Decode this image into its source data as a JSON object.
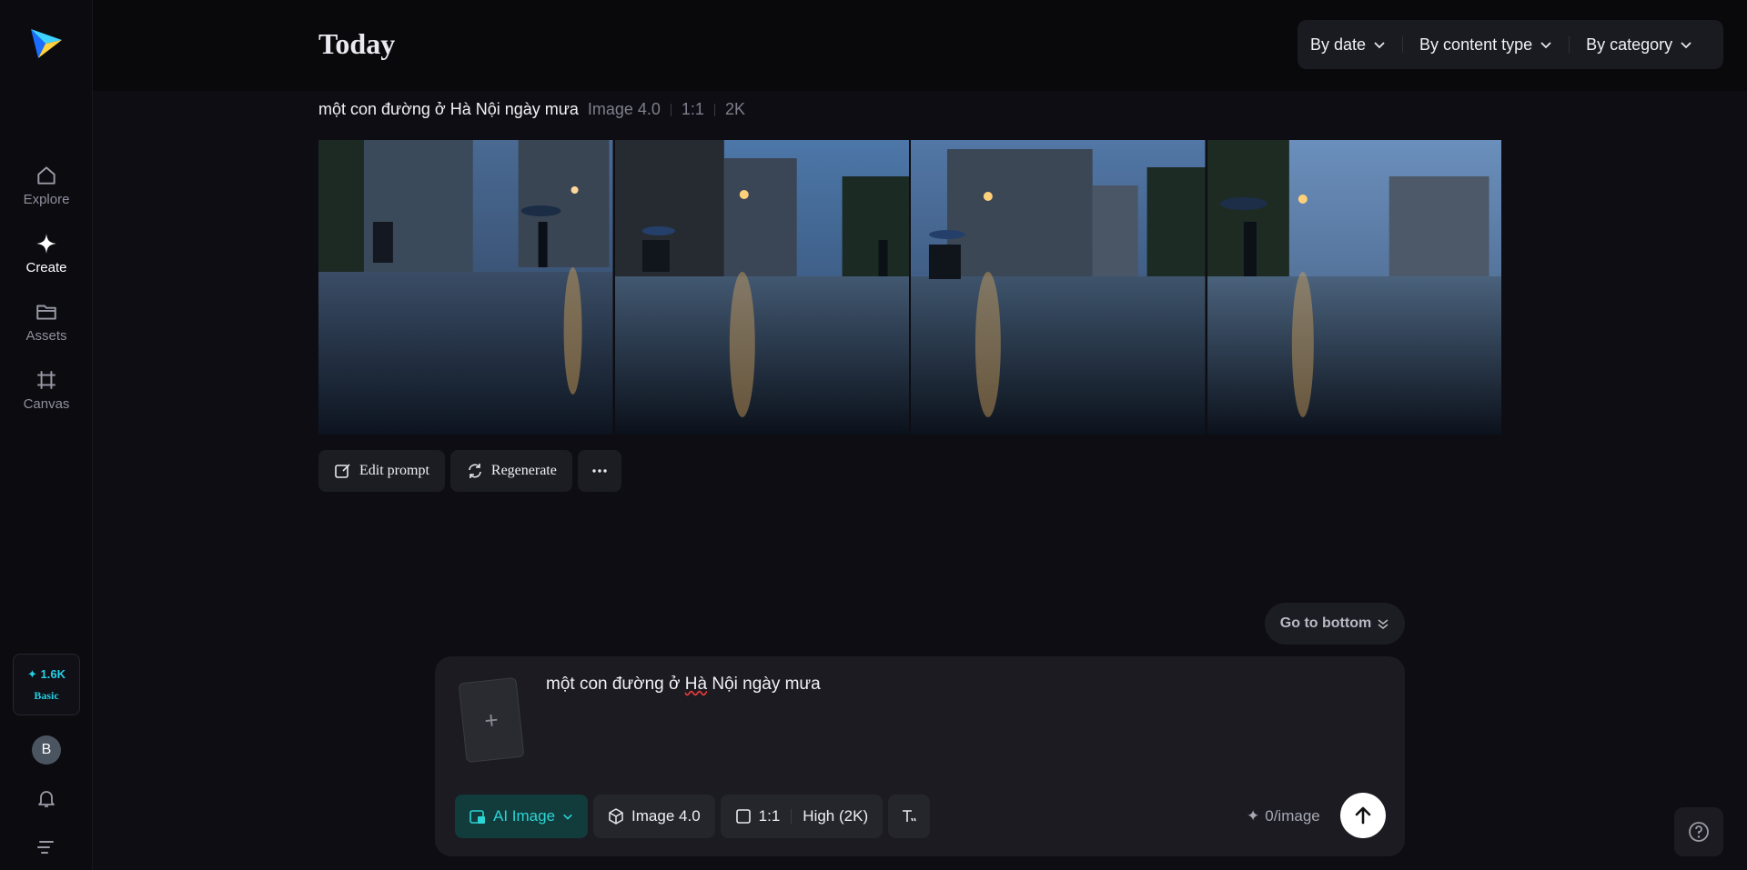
{
  "sidebar": {
    "items": [
      {
        "label": "Explore",
        "icon": "home-icon",
        "active": false
      },
      {
        "label": "Create",
        "icon": "sparkle-icon",
        "active": true
      },
      {
        "label": "Assets",
        "icon": "folder-icon",
        "active": false
      },
      {
        "label": "Canvas",
        "icon": "canvas-icon",
        "active": false
      }
    ],
    "credits": {
      "amount": "1.6K",
      "plan": "Basic"
    },
    "avatar_initial": "B"
  },
  "header": {
    "title": "Today",
    "filters": [
      {
        "label": "By date"
      },
      {
        "label": "By content type"
      },
      {
        "label": "By category"
      }
    ]
  },
  "generation": {
    "prompt": "một con đường ở Hà Nội ngày mưa",
    "model": "Image 4.0",
    "ratio": "1:1",
    "resolution": "2K",
    "image_count": 4,
    "actions": {
      "edit_label": "Edit prompt",
      "regenerate_label": "Regenerate"
    }
  },
  "go_bottom_label": "Go to bottom",
  "composer": {
    "input_value_pre": "một con đường ở ",
    "input_value_misspelled": "Hà",
    "input_value_post": " Nội ngày mưa",
    "mode_label": "AI Image",
    "model_label": "Image 4.0",
    "ratio_label": "1:1",
    "quality_label": "High (2K)",
    "cost_label": "0/image"
  },
  "colors": {
    "accent": "#25d0e6",
    "background": "#0d0d13",
    "panel": "#1b1b21"
  }
}
